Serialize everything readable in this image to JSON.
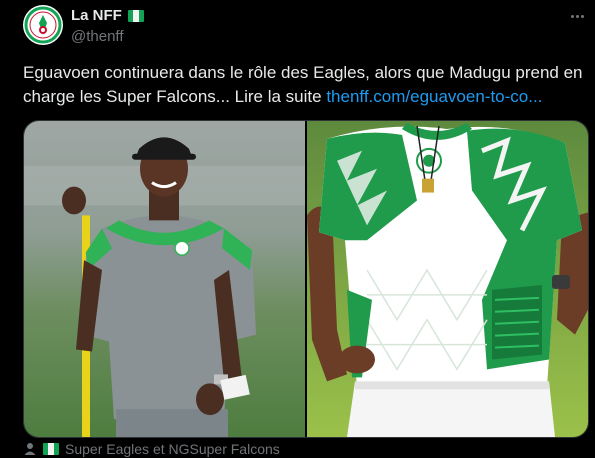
{
  "author": {
    "display_name": "La NFF",
    "handle": "@thenff",
    "flag_colors": [
      "#12a454",
      "#f4f4f4",
      "#12a454"
    ]
  },
  "tweet": {
    "text": "Eguavoen continuera dans le rôle des Eagles, alors que Madugu prend en charge les Super Falcons... Lire la suite ",
    "link_text": "thenff.com/eguavoen-to-co...",
    "link_color": "#1d9bf0"
  },
  "media": {
    "left_photo": "coach-with-cap-holding-pole",
    "right_photo": "green-white-jersey-torso"
  },
  "footer": {
    "communities": "Super Eagles et NGSuper Falcons"
  },
  "icons": {
    "more": "more-options-icon",
    "person": "person-icon"
  },
  "colors": {
    "background": "#000000",
    "text": "#e7e9ea",
    "muted": "#71767b",
    "accent": "#1d9bf0"
  }
}
